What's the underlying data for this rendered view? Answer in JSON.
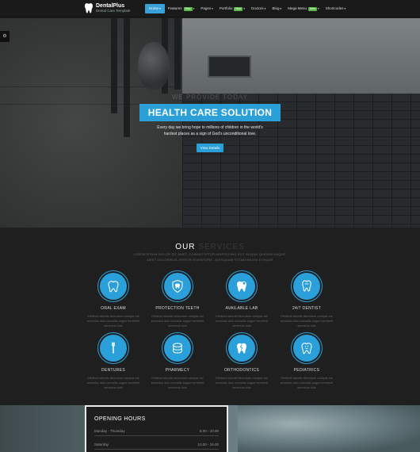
{
  "brand": {
    "name": "DentalPlus",
    "tagline": "Dental Care Template"
  },
  "nav": [
    {
      "label": "Home",
      "caret": true,
      "active": true
    },
    {
      "label": "Features",
      "badge": "New",
      "caret": true
    },
    {
      "label": "Pages",
      "caret": true
    },
    {
      "label": "Portfolio",
      "badge": "New",
      "caret": true
    },
    {
      "label": "Doctors",
      "caret": true
    },
    {
      "label": "Blog",
      "caret": true
    },
    {
      "label": "Mega Menu",
      "badge": "New",
      "caret": true
    },
    {
      "label": "Shortcodes",
      "caret": true
    }
  ],
  "caret_glyph": "▾",
  "hero": {
    "small": "WE PROVIDE TODAY",
    "title": "HEALTH CARE SOLUTION",
    "text": "Every day we bring hope to millions of children in the world's hardest places as a sign of God's unconditional love.",
    "button": "View Details"
  },
  "services": {
    "title_main": "OUR",
    "title_muted": "SERVICES",
    "description": "LOREM IPSUM DOLOR SIT AMET, CONSECTETUR ADIPISICING ELIT ACQUE QUIDEM EAQUE, AMET DOLORIBUS, ERROR INVENTORE, QUISQUAM TOTAM MAGNI EVNQUE",
    "items": [
      {
        "title": "ORAL EXAM",
        "icon": "tooth-icon",
        "text": "Eleifend lobortis bibendum volutpat est senectus duis convallis augue hendrerit senectus duis"
      },
      {
        "title": "PROTECTION TEETH",
        "icon": "shield-tooth-icon",
        "text": "Eleifend lobortis bibendum volutpat est senectus duis convallis augue hendrerit senectus duis"
      },
      {
        "title": "AVAILABLE LAB",
        "icon": "lab-tooth-icon",
        "text": "Eleifend lobortis bibendum volutpat est senectus duis convallis augue hendrerit senectus duis"
      },
      {
        "title": "24/7 DENTIST",
        "icon": "dentist-icon",
        "text": "Eleifend lobortis bibendum volutpat est senectus duis convallis augue hendrerit senectus duis"
      },
      {
        "title": "DENTURES",
        "icon": "toothbrush-icon",
        "text": "Eleifend lobortis bibendum volutpat est senectus duis convallis augue hendrerit senectus duis"
      },
      {
        "title": "PHARMECY",
        "icon": "pill-box-icon",
        "text": "Eleifend lobortis bibendum volutpat est senectus duis convallis augue hendrerit senectus duis"
      },
      {
        "title": "ORTHODONTICS",
        "icon": "cracked-tooth-icon",
        "text": "Eleifend lobortis bibendum volutpat est senectus duis convallis augue hendrerit senectus duis"
      },
      {
        "title": "PEDIATRICS",
        "icon": "kid-tooth-icon",
        "text": "Eleifend lobortis bibendum volutpat est senectus duis convallis augue hendrerit senectus duis"
      }
    ]
  },
  "hours": {
    "title": "OPENING HOURS",
    "rows": [
      {
        "day": "Monday - Thursday",
        "time": "8.00 - 20.00"
      },
      {
        "day": "Saturday",
        "time": "10.00 - 16.00"
      }
    ]
  },
  "colors": {
    "accent": "#2a9fd8",
    "badge": "#59b847",
    "background": "#1e1e1e"
  }
}
